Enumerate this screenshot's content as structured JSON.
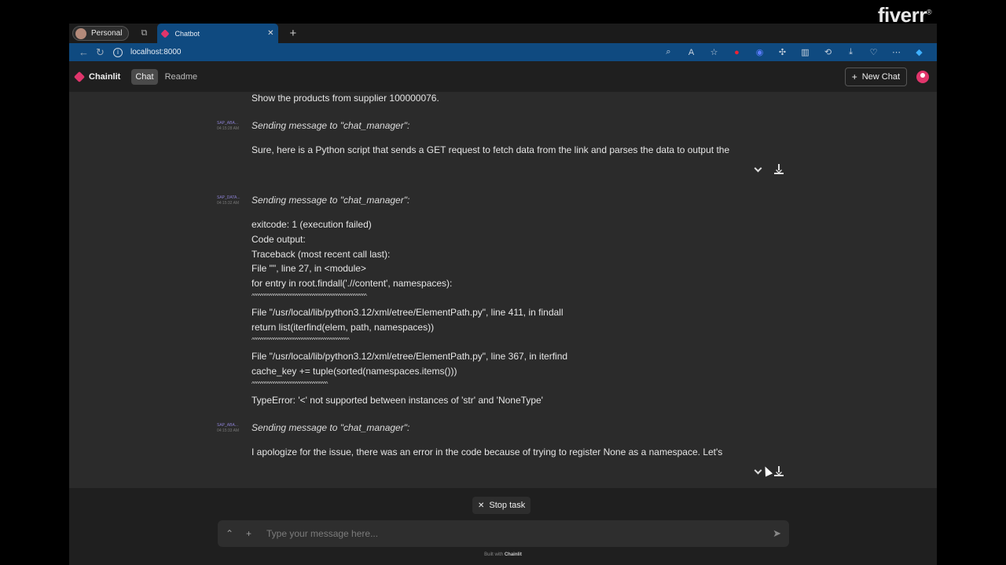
{
  "watermark": {
    "text": "fiverr",
    "mark": "®"
  },
  "browser": {
    "profile_label": "Personal",
    "tab_title": "Chatbot",
    "tab_close": "✕",
    "new_tab": "+",
    "url": "localhost:8000",
    "toolbar_icons": [
      "zoom-icon",
      "read-aloud-icon",
      "favorite-star-icon",
      "extension-red-icon",
      "extension-blue-icon",
      "extensions-icon",
      "split-screen-icon",
      "history-icon",
      "downloads-icon",
      "performance-icon",
      "more-icon",
      "copilot-icon"
    ]
  },
  "app": {
    "logo_text": "Chainlit",
    "nav": [
      "Chat",
      "Readme"
    ],
    "new_chat_label": "New Chat"
  },
  "chat": {
    "user_message": "Show the products from supplier 100000076.",
    "messages": [
      {
        "author": "SAP_ABA...",
        "time": "04:15:28 AM",
        "header": "Sending message to \"chat_manager\":",
        "lines": [
          "Sure, here is a Python script that sends a GET request to fetch data from the link and parses the data to output the"
        ]
      },
      {
        "author": "SAP_DATA...",
        "time": "04:15:32 AM",
        "header": "Sending message to \"chat_manager\":",
        "lines": [
          "exitcode: 1 (execution failed)",
          "Code output:",
          "Traceback (most recent call last):",
          "File \"\", line 27, in <module>",
          "for entry in root.findall('.//content', namespaces):",
          "^^^^^^^^^^^^^^^^^^^^^^^^^^^^^^^^^^^^^^^^^^^^^^^^^^^^^",
          "File \"/usr/local/lib/python3.12/xml/etree/ElementPath.py\", line 411, in findall",
          "return list(iterfind(elem, path, namespaces))",
          "^^^^^^^^^^^^^^^^^^^^^^^^^^^^^^^^^^^^^^^^^^^^^",
          "File \"/usr/local/lib/python3.12/xml/etree/ElementPath.py\", line 367, in iterfind",
          "cache_key += tuple(sorted(namespaces.items()))",
          "^^^^^^^^^^^^^^^^^^^^^^^^^^^^^^^^^^^",
          "TypeError: '<' not supported between instances of 'str' and 'NoneType'"
        ]
      },
      {
        "author": "SAP_ABA...",
        "time": "04:15:33 AM",
        "header": "Sending message to \"chat_manager\":",
        "lines": [
          "I apologize for the issue, there was an error in the code because of trying to register None as a namespace. Let's"
        ]
      }
    ]
  },
  "composer": {
    "stop_label": "Stop task",
    "placeholder": "Type your message here...",
    "built_with_prefix": "Built with",
    "built_with_brand": "Chainlit"
  }
}
